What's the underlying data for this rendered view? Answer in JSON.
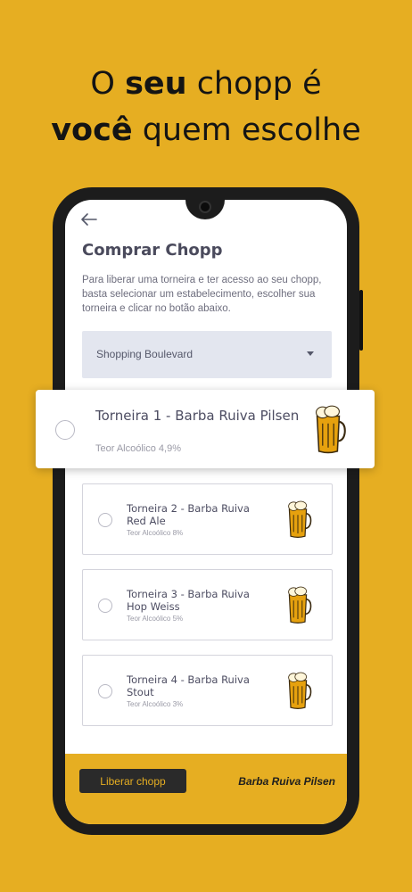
{
  "headline": {
    "line1_pre": "O ",
    "line1_bold": "seu",
    "line1_post": " chopp é",
    "line2_bold": "você",
    "line2_post": " quem escolhe"
  },
  "screen": {
    "title": "Comprar Chopp",
    "description": "Para liberar uma torneira e ter acesso ao seu chopp, basta selecionar um estabelecimento, escolher sua torneira e clicar no botão abaixo.",
    "establishment_select": {
      "value": "Shopping Boulevard"
    },
    "taps": [
      {
        "name": "Torneira 1 - Barba Ruiva Pilsen",
        "abv": "Teor Alcoólico 4,9%",
        "highlighted": true
      },
      {
        "name": "Torneira 2 - Barba Ruiva Red Ale",
        "abv": "Teor Alcoólico 8%"
      },
      {
        "name": "Torneira 3 - Barba Ruiva Hop Weiss",
        "abv": "Teor Alcoólico 5%"
      },
      {
        "name": "Torneira 4 - Barba Ruiva Stout",
        "abv": "Teor Alcoólico 3%"
      }
    ],
    "footer": {
      "button_label": "Liberar chopp",
      "selected_label": "Barba Ruiva Pilsen"
    }
  },
  "colors": {
    "background": "#E6AE22",
    "dark": "#2a2a2a",
    "select_bg": "#E3E6EF",
    "text_primary": "#4d4d62"
  },
  "icons": [
    "back-arrow-icon",
    "chevron-down-icon",
    "beer-mug-icon",
    "radio-icon"
  ]
}
